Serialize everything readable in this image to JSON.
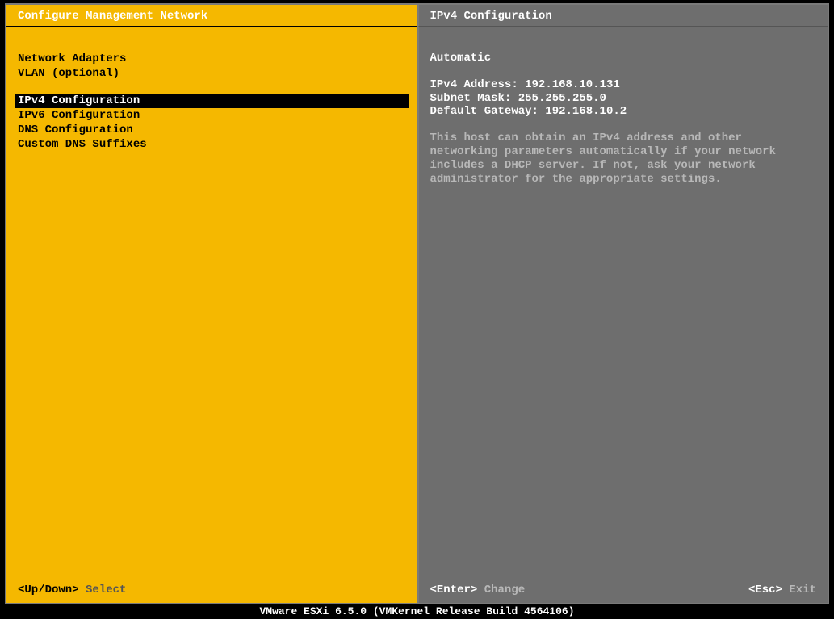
{
  "header": {
    "left_title": "Configure Management Network",
    "right_title": "IPv4 Configuration"
  },
  "menu": {
    "group1": [
      "Network Adapters",
      "VLAN (optional)"
    ],
    "group2": [
      "IPv4 Configuration",
      "IPv6 Configuration",
      "DNS Configuration",
      "Custom DNS Suffixes"
    ],
    "selected": "IPv4 Configuration"
  },
  "detail": {
    "mode": "Automatic",
    "ipv4_label": "IPv4 Address:",
    "ipv4_value": "192.168.10.131",
    "subnet_label": "Subnet Mask:",
    "subnet_value": "255.255.255.0",
    "gateway_label": "Default Gateway:",
    "gateway_value": "192.168.10.2",
    "help": "This host can obtain an IPv4 address and other networking parameters automatically if your network includes a DHCP server. If not, ask your network administrator for the appropriate settings."
  },
  "footer": {
    "left_key": "<Up/Down>",
    "left_action": "Select",
    "right_key1": "<Enter>",
    "right_action1": "Change",
    "right_key2": "<Esc>",
    "right_action2": "Exit"
  },
  "bottom_bar": "VMware ESXi 6.5.0 (VMKernel Release Build 4564106)"
}
